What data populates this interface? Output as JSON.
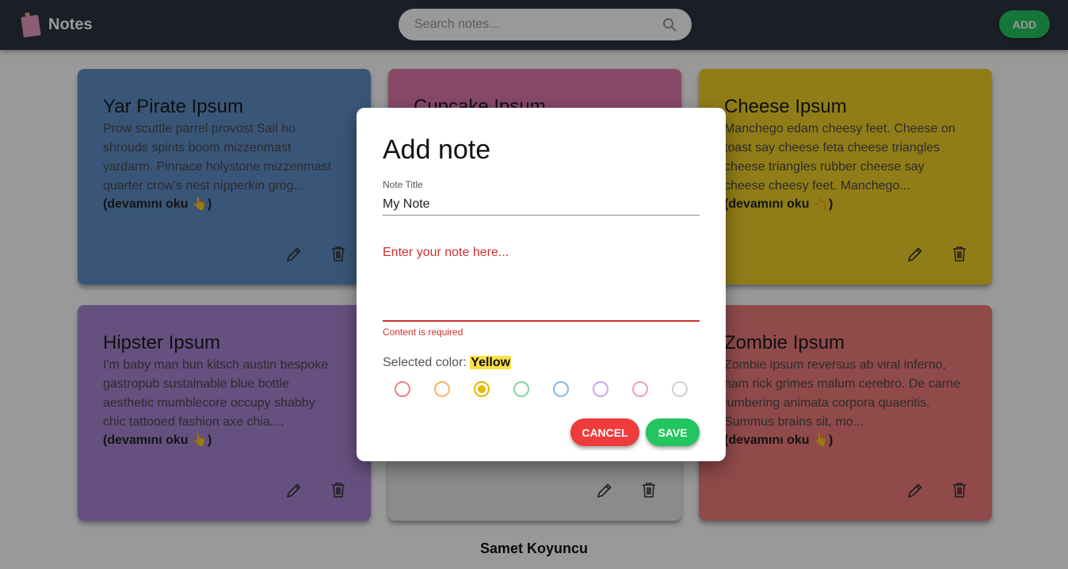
{
  "header": {
    "brand": "Notes",
    "search_placeholder": "Search notes...",
    "add_label": "ADD"
  },
  "notes": [
    {
      "title": "Yar Pirate Ipsum",
      "text": "Prow scuttle parrel provost Sail ho shrouds spirits boom mizzenmast yardarm. Pinnace holystone mizzenmast quarter crow's nest nipperkin grog...",
      "read_more": "(devamını oku 👆)",
      "color": "#5f8fc9"
    },
    {
      "title": "Cupcake Ipsum",
      "text": "",
      "read_more": "",
      "color": "#e37bb0"
    },
    {
      "title": "Cheese Ipsum",
      "text": "Manchego edam cheesy feet. Cheese on toast say cheese feta cheese triangles cheese triangles rubber cheese say cheese cheesy feet. Manchego...",
      "read_more": "(devamını oku 👆)",
      "color": "#f2d027"
    },
    {
      "title": "Hipster Ipsum",
      "text": "I'm baby man bun kitsch austin bespoke gastropub sustainable blue bottle aesthetic mumblecore occupy shabby chic tattooed fashion axe chia....",
      "read_more": "(devamını oku 👆)",
      "color": "#aa86d6"
    },
    {
      "title": "",
      "text": "",
      "read_more": "",
      "color": "#e8e8ea"
    },
    {
      "title": "Zombie Ipsum",
      "text": "Zombie ipsum reversus ab viral inferno, nam rick grimes malum cerebro. De carne lumbering animata corpora quaeritis. Summus brains sit, mo...",
      "read_more": "(devamını oku 👆)",
      "color": "#f07c7c"
    }
  ],
  "footer": {
    "name": "Samet Koyuncu"
  },
  "modal": {
    "title": "Add note",
    "title_label": "Note Title",
    "title_value": "My Note",
    "content_placeholder": "Enter your note here...",
    "content_error": "Content is required",
    "selected_color_label": "Selected color:",
    "selected_color": "Yellow",
    "colors": [
      {
        "name": "red",
        "hex": "#f27d8a",
        "selected": false
      },
      {
        "name": "orange",
        "hex": "#f6b26b",
        "selected": false
      },
      {
        "name": "yellow",
        "hex": "#e6b800",
        "selected": true
      },
      {
        "name": "green",
        "hex": "#7fd8a4",
        "selected": false
      },
      {
        "name": "blue",
        "hex": "#84b8ea",
        "selected": false
      },
      {
        "name": "purple",
        "hex": "#cfa3e6",
        "selected": false
      },
      {
        "name": "pink",
        "hex": "#f19cc6",
        "selected": false
      },
      {
        "name": "gray",
        "hex": "#cfcfcf",
        "selected": false
      }
    ],
    "cancel_label": "CANCEL",
    "save_label": "SAVE"
  }
}
